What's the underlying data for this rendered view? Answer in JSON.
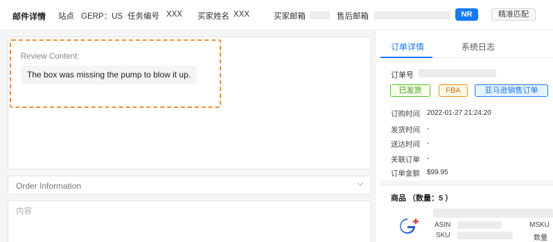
{
  "header": {
    "title": "邮件详情",
    "site_label": "站点",
    "site_value": "GERP：US",
    "task_label": "任务编号",
    "task_value": "XXX",
    "buyer_name_label": "买家姓名",
    "buyer_name_value": "XXX",
    "buyer_email_label": "买家邮箱",
    "aftersale_email_label": "售后邮箱",
    "nr_badge": "NR",
    "match_button": "精准匹配"
  },
  "review": {
    "label": "Review Content:",
    "text": "The box was missing the pump to blow it up."
  },
  "order_info": {
    "label": "Order Information"
  },
  "content_input": {
    "placeholder": "内容"
  },
  "right_panel": {
    "tabs": [
      {
        "label": "订单详情",
        "active": true
      },
      {
        "label": "系统日志",
        "active": false
      }
    ],
    "order_no_label": "订单号",
    "tags": [
      "已发货",
      "FBA",
      "亚马逊销售订单"
    ],
    "fields": [
      {
        "label": "订购时间",
        "value": "2022-01-27 21:24:20"
      },
      {
        "label": "发货时间",
        "value": "-"
      },
      {
        "label": "送达时间",
        "value": "-"
      },
      {
        "label": "关联订单",
        "value": "-"
      },
      {
        "label": "订单金额",
        "value": "$99.95"
      }
    ],
    "products_header": "商品 （数量：5 ）",
    "product": {
      "asin_label": "ASIN",
      "sku_label": "SKU",
      "msku_label": "MSKU",
      "qty_label": "数量"
    }
  },
  "colors": {
    "accent": "#1677ff",
    "dashed_highlight": "#f28a2e"
  }
}
